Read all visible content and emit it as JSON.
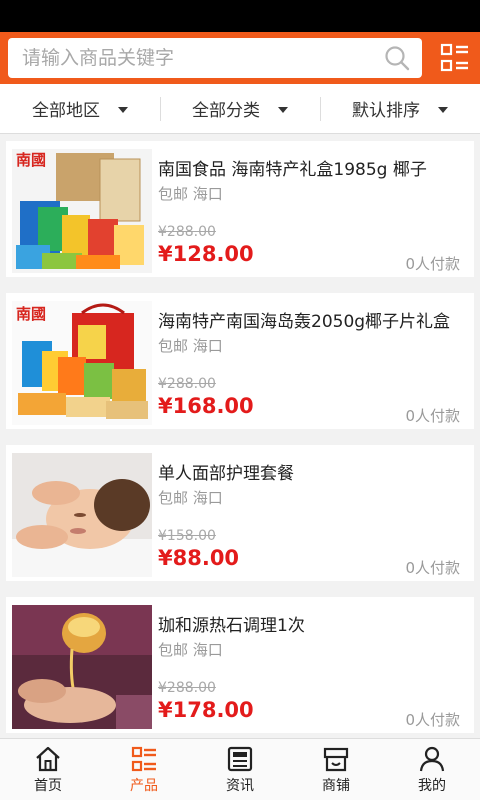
{
  "search": {
    "placeholder": "请输入商品关键字"
  },
  "filters": [
    {
      "label": "全部地区"
    },
    {
      "label": "全部分类"
    },
    {
      "label": "默认排序"
    }
  ],
  "products": [
    {
      "title": "南国食品 海南特产礼盒1985g 椰子",
      "shipping": "包邮",
      "location": "海口",
      "old_price": "¥288.00",
      "price": "¥128.00",
      "paid": "0人付款",
      "thumb_brand": "南國"
    },
    {
      "title": "海南特产南国海岛轰2050g椰子片礼盒",
      "shipping": "包邮",
      "location": "海口",
      "old_price": "¥288.00",
      "price": "¥168.00",
      "paid": "0人付款",
      "thumb_brand": "南國"
    },
    {
      "title": "单人面部护理套餐",
      "shipping": "包邮",
      "location": "海口",
      "old_price": "¥158.00",
      "price": "¥88.00",
      "paid": "0人付款"
    },
    {
      "title": "珈和源热石调理1次",
      "shipping": "包邮",
      "location": "海口",
      "old_price": "¥288.00",
      "price": "¥178.00",
      "paid": "0人付款"
    }
  ],
  "tabs": [
    {
      "label": "首页",
      "icon": "home-icon"
    },
    {
      "label": "产品",
      "icon": "list-icon"
    },
    {
      "label": "资讯",
      "icon": "news-icon"
    },
    {
      "label": "商铺",
      "icon": "store-icon"
    },
    {
      "label": "我的",
      "icon": "user-icon"
    }
  ],
  "colors": {
    "accent": "#f05a1b",
    "price": "#e31b1b",
    "brand_red": "#d7261f"
  }
}
